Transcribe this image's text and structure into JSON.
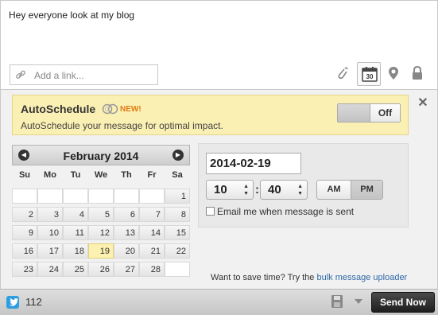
{
  "compose": {
    "message": "Hey everyone look at my blog",
    "link_placeholder": "Add a link...",
    "calendar_button_label": "30"
  },
  "autoschedule": {
    "title": "AutoSchedule",
    "badge": "NEW!",
    "description": "AutoSchedule your message for optimal impact.",
    "toggle_off_label": "Off",
    "toggle_state": "off",
    "close_label": "✕"
  },
  "calendar": {
    "month_label": "February 2014",
    "weekdays": [
      "Su",
      "Mo",
      "Tu",
      "We",
      "Th",
      "Fr",
      "Sa"
    ],
    "days": [
      "1",
      "2",
      "3",
      "4",
      "5",
      "6",
      "7",
      "8",
      "9",
      "10",
      "11",
      "12",
      "13",
      "14",
      "15",
      "16",
      "17",
      "18",
      "19",
      "20",
      "21",
      "22",
      "23",
      "24",
      "25",
      "26",
      "27",
      "28"
    ],
    "selected_day": "19"
  },
  "time": {
    "date_value": "2014-02-19",
    "hour": "10",
    "minute": "40",
    "am_label": "AM",
    "pm_label": "PM",
    "period_selected": "PM",
    "email_label": "Email me when message is sent"
  },
  "uploader": {
    "prefix": "Want to save time? Try the ",
    "link_text": "bulk message uploader"
  },
  "bottom": {
    "char_count": "112",
    "send_label": "Send Now"
  },
  "colors": {
    "autoschedule_bg": "#fbf0b3",
    "new_badge": "#e07a15",
    "twitter": "#2d9ee0",
    "link": "#2f6aa8",
    "today_highlight": "#fcf1b0"
  },
  "icons": [
    "link-icon",
    "paperclip-icon",
    "calendar-icon",
    "location-pin-icon",
    "lock-icon",
    "autoschedule-logo-icon",
    "close-icon",
    "chevron-left-icon",
    "chevron-right-icon",
    "twitter-icon",
    "save-draft-icon",
    "dropdown-arrow-icon"
  ]
}
